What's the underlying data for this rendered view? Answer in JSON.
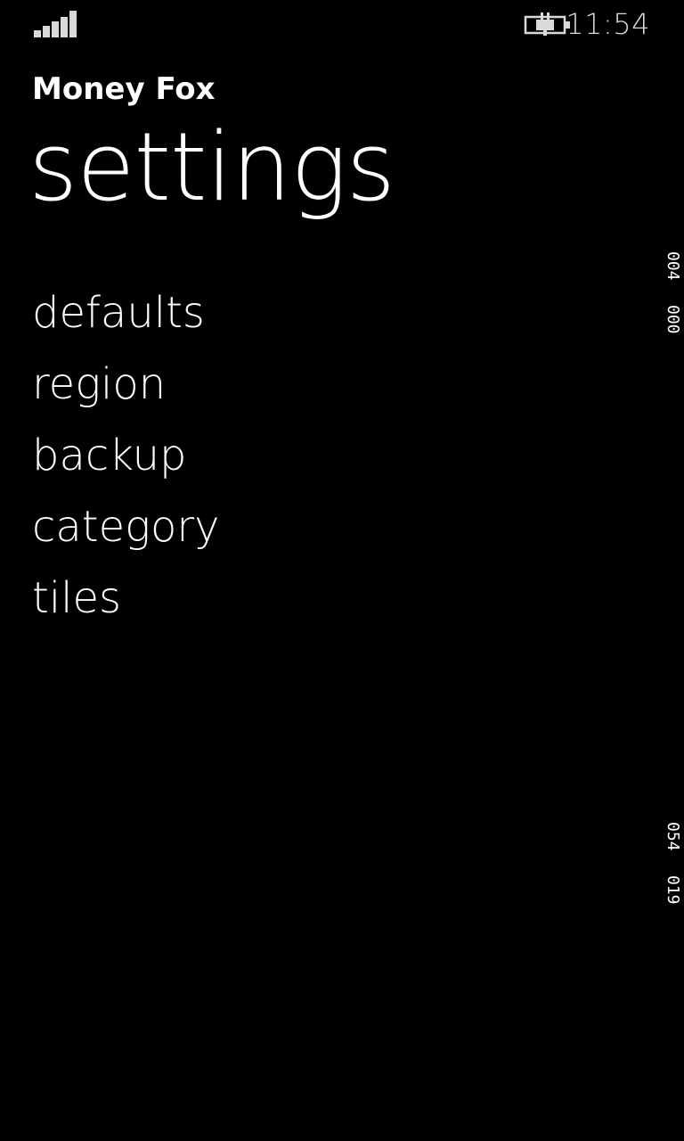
{
  "status_bar": {
    "signal_icon": "signal-strength-icon",
    "battery_icon": "battery-charging-icon",
    "time": "11:54"
  },
  "header": {
    "app_name": "Money Fox",
    "page_title": "settings"
  },
  "menu": {
    "items": [
      {
        "label": "defaults"
      },
      {
        "label": "region"
      },
      {
        "label": "backup"
      },
      {
        "label": "category"
      },
      {
        "label": "tiles"
      }
    ]
  },
  "debug_counters": [
    {
      "value": "004"
    },
    {
      "value": "000"
    },
    {
      "value": "054"
    },
    {
      "value": "019"
    }
  ],
  "colors": {
    "background": "#000000",
    "foreground": "#ffffff",
    "status_foreground": "#d9d9d9"
  }
}
